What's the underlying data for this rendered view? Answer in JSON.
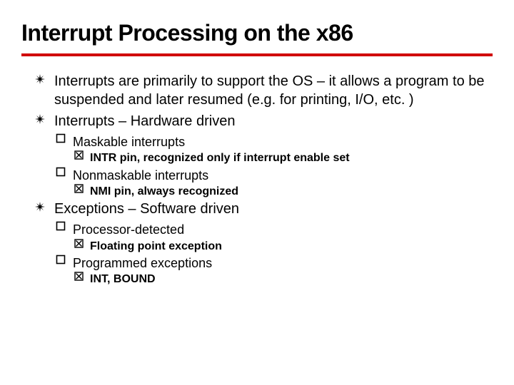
{
  "title": "Interrupt Processing on the x86",
  "items": [
    {
      "level": 1,
      "text": "Interrupts are primarily to support the OS – it allows a program to be suspended and later resumed (e.g. for printing, I/O, etc. )"
    },
    {
      "level": 1,
      "text": "Interrupts – Hardware driven"
    },
    {
      "level": 2,
      "text": "Maskable interrupts"
    },
    {
      "level": 3,
      "text": "INTR pin, recognized only if interrupt enable set"
    },
    {
      "level": 2,
      "text": "Nonmaskable interrupts"
    },
    {
      "level": 3,
      "text": "NMI pin, always recognized"
    },
    {
      "level": 1,
      "text": "Exceptions – Software driven"
    },
    {
      "level": 2,
      "text": "Processor-detected"
    },
    {
      "level": 3,
      "text": "Floating point exception"
    },
    {
      "level": 2,
      "text": "Programmed exceptions"
    },
    {
      "level": 3,
      "text": "INT, BOUND"
    }
  ]
}
